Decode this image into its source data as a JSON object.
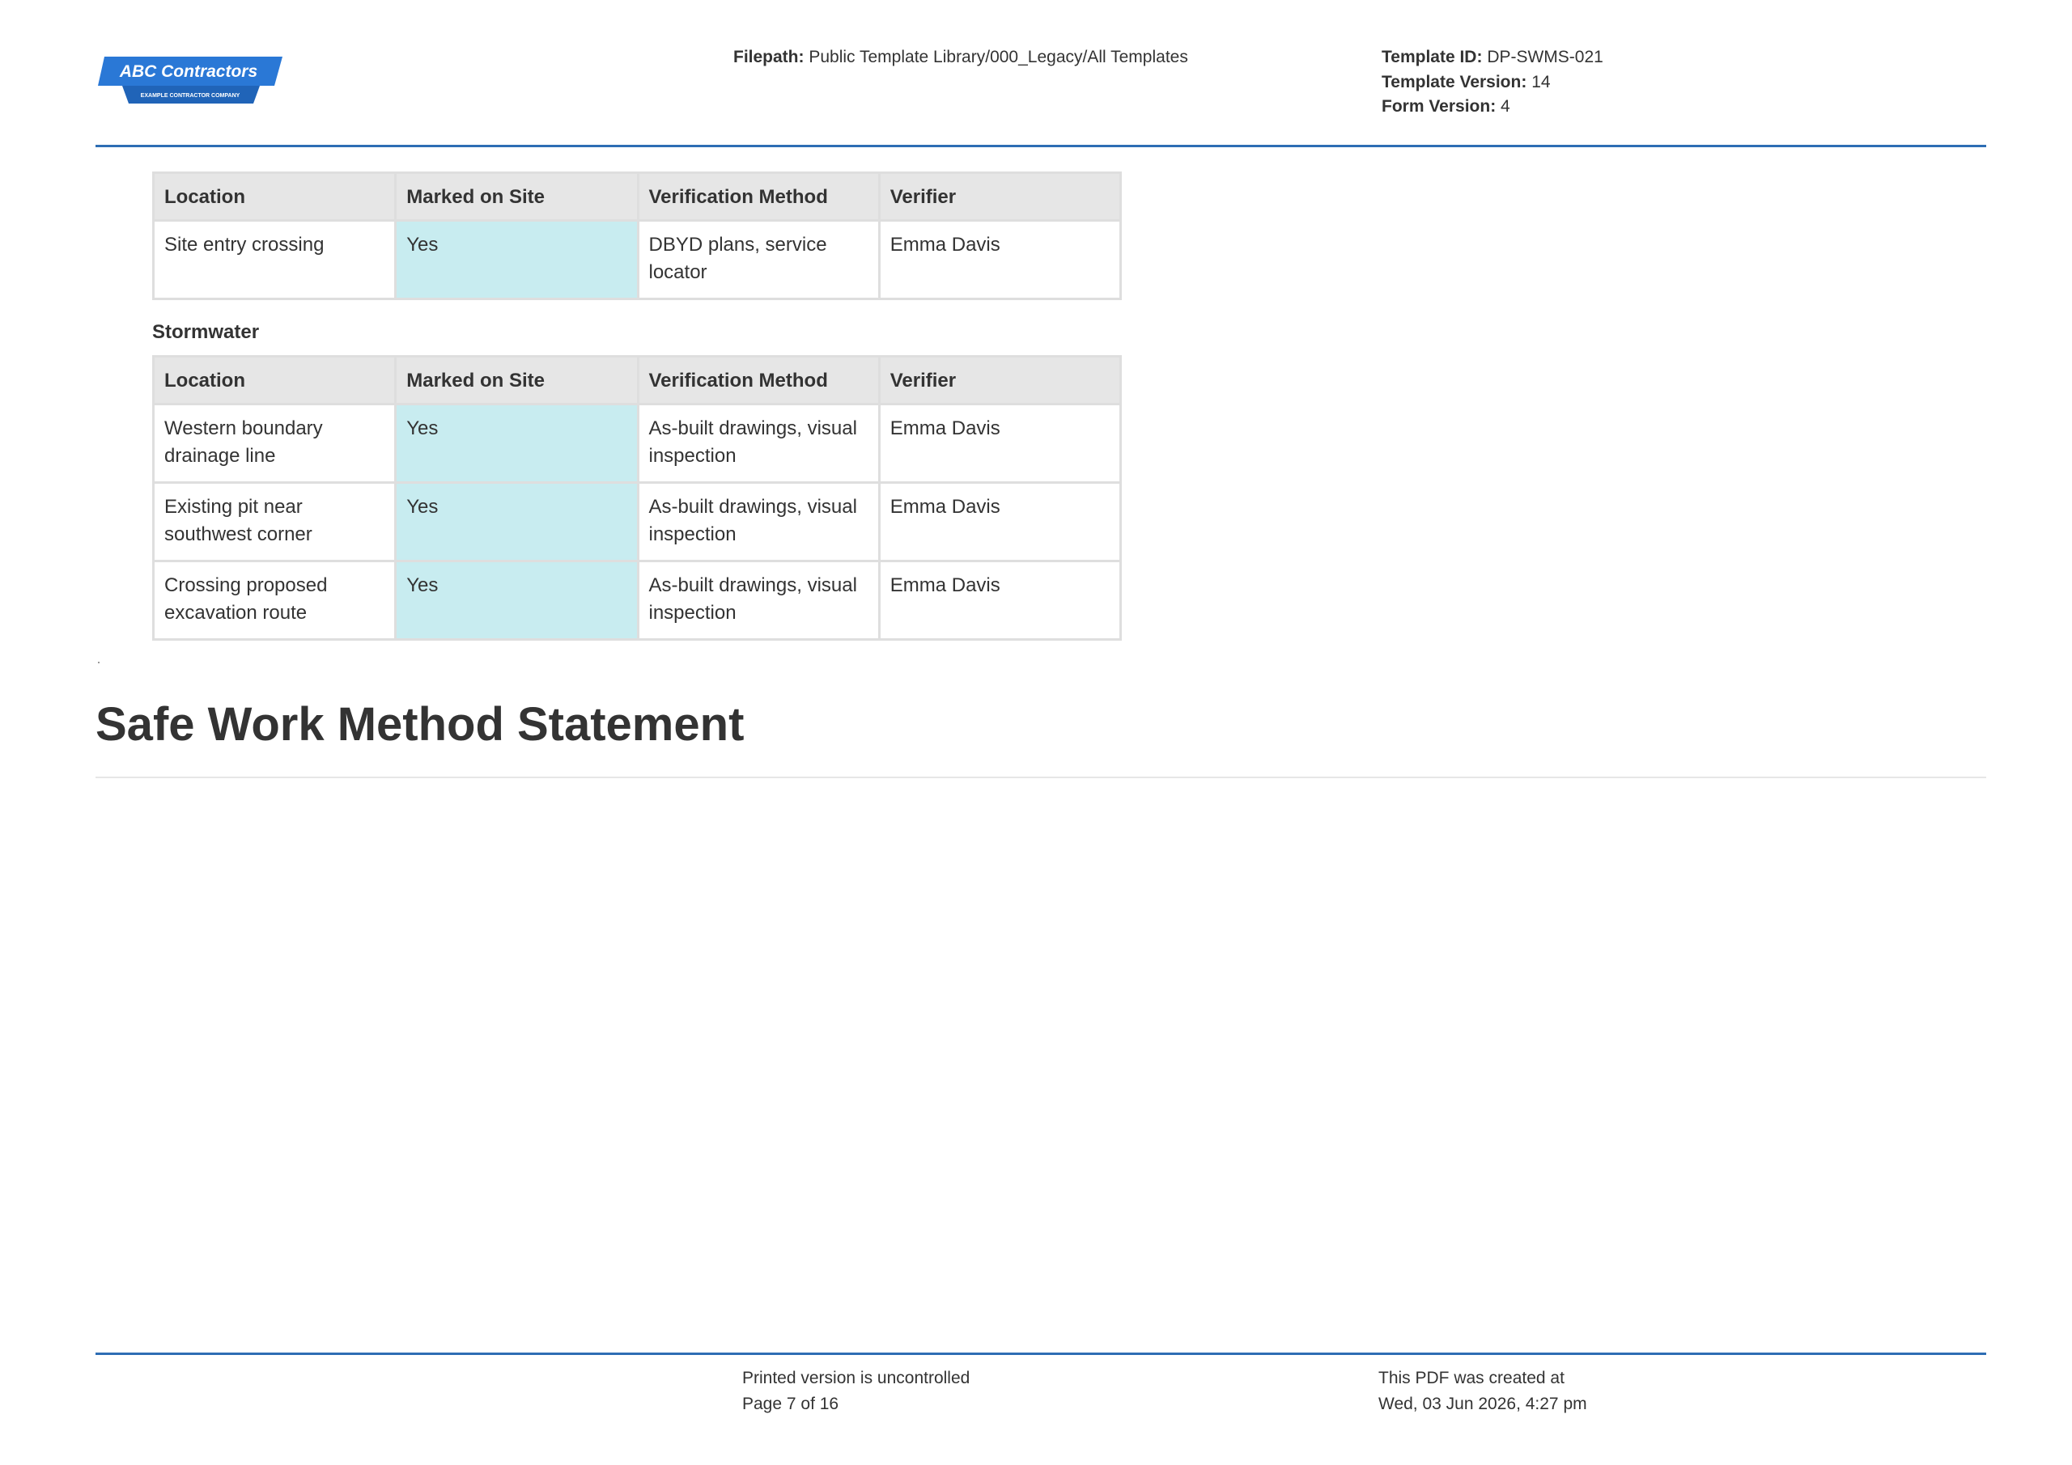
{
  "header": {
    "logo": {
      "title": "ABC Contractors",
      "tagline": "EXAMPLE CONTRACTOR COMPANY",
      "color": "#2a78d6"
    },
    "filepath_label": "Filepath:",
    "filepath_value": "Public Template Library/000_Legacy/All Templates",
    "template_id_label": "Template ID:",
    "template_id_value": "DP-SWMS-021",
    "template_version_label": "Template Version:",
    "template_version_value": "14",
    "form_version_label": "Form Version:",
    "form_version_value": "4"
  },
  "columns": {
    "location": "Location",
    "marked": "Marked on Site",
    "method": "Verification Method",
    "verifier": "Verifier"
  },
  "table1": {
    "rows": [
      {
        "location": "Site entry crossing",
        "marked": "Yes",
        "method": "DBYD plans, service locator",
        "verifier": "Emma Davis"
      }
    ]
  },
  "stormwater": {
    "label": "Stormwater",
    "rows": [
      {
        "location": "Western boundary drainage line",
        "marked": "Yes",
        "method": "As-built drawings, visual inspection",
        "verifier": "Emma Davis"
      },
      {
        "location": "Existing pit near southwest corner",
        "marked": "Yes",
        "method": "As-built drawings, visual inspection",
        "verifier": "Emma Davis"
      },
      {
        "location": "Crossing proposed excavation route",
        "marked": "Yes",
        "method": "As-built drawings, visual inspection",
        "verifier": "Emma Davis"
      }
    ]
  },
  "section": {
    "heading": "Safe Work Method Statement"
  },
  "footer": {
    "uncontrolled": "Printed version is uncontrolled",
    "page": "Page 7 of 16",
    "created_label": "This PDF was created at",
    "created_value": "Wed, 03 Jun 2026, 4:27 pm"
  },
  "colors": {
    "accent_rule": "#2e6db4",
    "header_cell": "#e6e6e6",
    "highlight_cell": "#c8ecf0",
    "text": "#333333"
  }
}
